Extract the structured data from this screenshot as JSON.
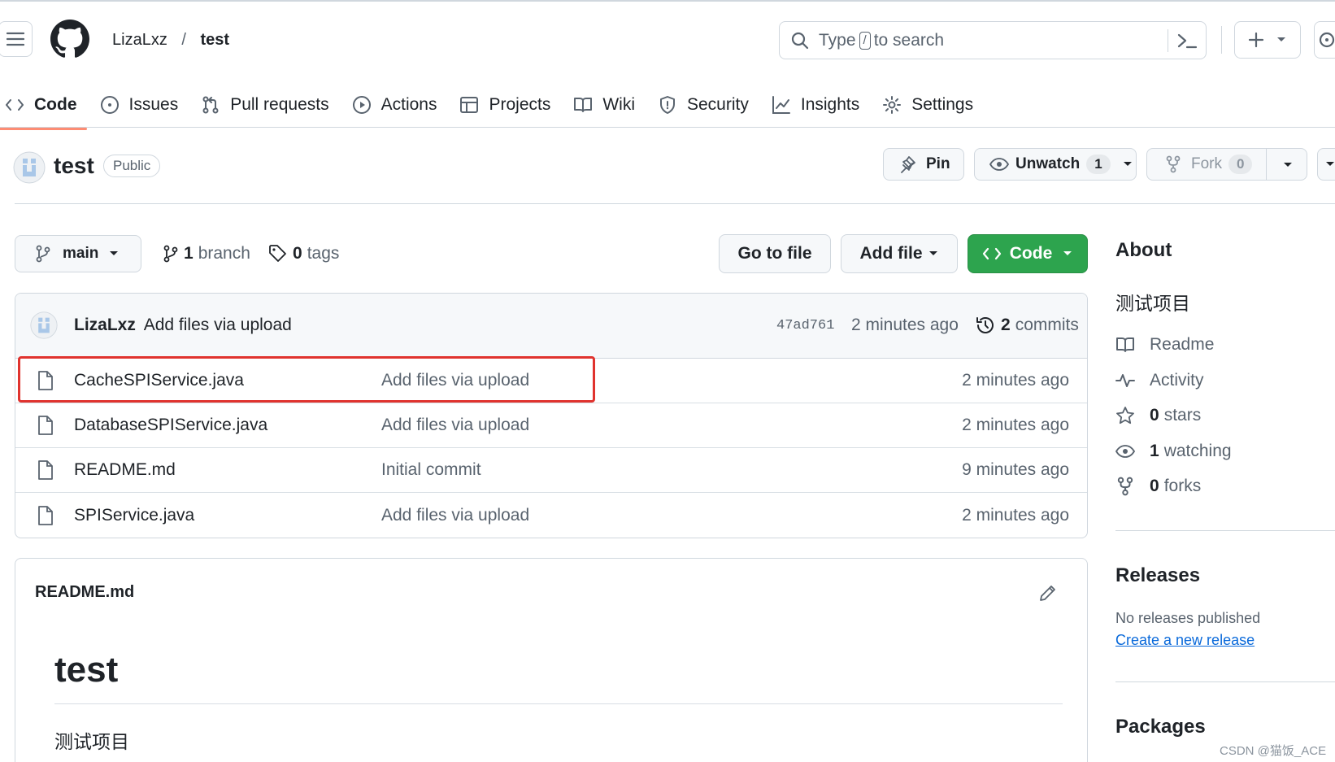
{
  "header": {
    "owner": "LizaLxz",
    "separator": "/",
    "repo": "test",
    "search_prefix": "Type",
    "search_key": "/",
    "search_suffix": "to search"
  },
  "nav": {
    "tabs": [
      {
        "label": "Code",
        "icon": "code-icon",
        "active": true
      },
      {
        "label": "Issues",
        "icon": "issue-icon"
      },
      {
        "label": "Pull requests",
        "icon": "pull-request-icon"
      },
      {
        "label": "Actions",
        "icon": "play-icon"
      },
      {
        "label": "Projects",
        "icon": "table-icon"
      },
      {
        "label": "Wiki",
        "icon": "book-icon"
      },
      {
        "label": "Security",
        "icon": "shield-icon"
      },
      {
        "label": "Insights",
        "icon": "graph-icon"
      },
      {
        "label": "Settings",
        "icon": "gear-icon"
      }
    ]
  },
  "repo": {
    "name": "test",
    "visibility": "Public",
    "pin_label": "Pin",
    "unwatch_label": "Unwatch",
    "watch_count": "1",
    "fork_label": "Fork",
    "fork_count": "0"
  },
  "toolbar": {
    "branch": "main",
    "branch_count": "1",
    "branch_label": "branch",
    "tag_count": "0",
    "tag_label": "tags",
    "go_to_file": "Go to file",
    "add_file": "Add file",
    "code": "Code"
  },
  "latest_commit": {
    "author": "LizaLxz",
    "message": "Add files via upload",
    "sha": "47ad761",
    "time": "2 minutes ago",
    "commit_count": "2",
    "commit_label": "commits"
  },
  "files": [
    {
      "name": "CacheSPIService.java",
      "message": "Add files via upload",
      "time": "2 minutes ago"
    },
    {
      "name": "DatabaseSPIService.java",
      "message": "Add files via upload",
      "time": "2 minutes ago"
    },
    {
      "name": "README.md",
      "message": "Initial commit",
      "time": "9 minutes ago"
    },
    {
      "name": "SPIService.java",
      "message": "Add files via upload",
      "time": "2 minutes ago"
    }
  ],
  "readme": {
    "filename": "README.md",
    "heading": "test",
    "body": "测试项目"
  },
  "about": {
    "title": "About",
    "description": "测试项目",
    "readme_label": "Readme",
    "activity_label": "Activity",
    "stars_count": "0",
    "stars_label": "stars",
    "watching_count": "1",
    "watching_label": "watching",
    "forks_count": "0",
    "forks_label": "forks"
  },
  "releases": {
    "title": "Releases",
    "empty": "No releases published",
    "create_link": "Create a new release"
  },
  "packages": {
    "title": "Packages"
  },
  "watermark": "CSDN @猫饭_ACE",
  "colors": {
    "accent_green": "#2da44e",
    "link_blue": "#0969da",
    "highlight_red": "#e0332e",
    "tab_underline": "#fd8c73"
  }
}
